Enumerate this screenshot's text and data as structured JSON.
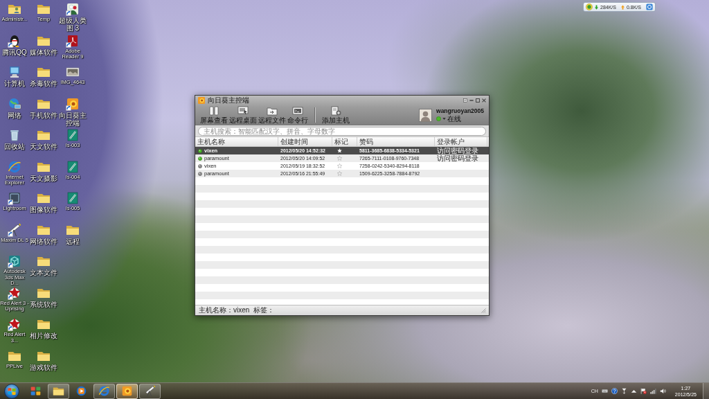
{
  "desktop_icons": [
    {
      "label": "Administr...",
      "kind": "user-folder",
      "shortcut": false
    },
    {
      "label": "腾讯QQ",
      "kind": "penguin",
      "shortcut": true
    },
    {
      "label": "计算机",
      "kind": "computer",
      "shortcut": false
    },
    {
      "label": "网络",
      "kind": "network",
      "shortcut": false
    },
    {
      "label": "回收站",
      "kind": "trash",
      "shortcut": false
    },
    {
      "label": "Internet Explorer",
      "kind": "ie",
      "shortcut": false
    },
    {
      "label": "Lightroom",
      "kind": "dark-tile",
      "shortcut": true
    },
    {
      "label": "Maxim DL 5",
      "kind": "telescope",
      "shortcut": true
    },
    {
      "label": "Autodesk 3ds Max D...",
      "kind": "m-tile",
      "shortcut": true
    },
    {
      "label": "Red Alert 3 - Uprising",
      "kind": "star",
      "shortcut": true
    },
    {
      "label": "Red Alert 3...",
      "kind": "star",
      "shortcut": true
    },
    {
      "label": "PPLive",
      "kind": "folder",
      "shortcut": false
    },
    {
      "label": "Temp",
      "kind": "folder",
      "shortcut": false
    },
    {
      "label": "媒体软件",
      "kind": "folder",
      "shortcut": false
    },
    {
      "label": "杀毒软件",
      "kind": "folder",
      "shortcut": false
    },
    {
      "label": "手机软件",
      "kind": "folder",
      "shortcut": false
    },
    {
      "label": "天文软件",
      "kind": "folder",
      "shortcut": false
    },
    {
      "label": "天文摄影",
      "kind": "folder",
      "shortcut": false
    },
    {
      "label": "图像软件",
      "kind": "folder",
      "shortcut": false
    },
    {
      "label": "网络软件",
      "kind": "folder",
      "shortcut": false
    },
    {
      "label": "文本文件",
      "kind": "folder",
      "shortcut": false
    },
    {
      "label": "系统软件",
      "kind": "folder",
      "shortcut": false
    },
    {
      "label": "相片修改",
      "kind": "folder",
      "shortcut": false
    },
    {
      "label": "游戏软件",
      "kind": "folder",
      "shortcut": false
    },
    {
      "label": "超级人类图 3",
      "kind": "flower",
      "shortcut": true
    },
    {
      "label": "Adobe Reader 9",
      "kind": "pdf",
      "shortcut": true
    },
    {
      "label": "IMG_4643",
      "kind": "photo",
      "shortcut": false
    },
    {
      "label": "向日葵主控端",
      "kind": "sunflower",
      "shortcut": true
    },
    {
      "label": "Is-003",
      "kind": "pen-tile",
      "shortcut": false
    },
    {
      "label": "Is-004",
      "kind": "pen-tile",
      "shortcut": false
    },
    {
      "label": "Is-005",
      "kind": "pen-tile",
      "shortcut": false
    },
    {
      "label": "远程",
      "kind": "folder",
      "shortcut": false
    }
  ],
  "net_widget": {
    "download": "284K/S",
    "upload": "0.8K/S"
  },
  "window": {
    "title": "向日葵主控端",
    "toolbar_groups": [
      {
        "buttons": [
          {
            "label": "屏幕查看",
            "kind": "screen"
          },
          {
            "label": "远程桌面",
            "kind": "desktop"
          },
          {
            "label": "远程文件",
            "kind": "file"
          },
          {
            "label": "命令行",
            "kind": "cmd"
          }
        ]
      },
      {
        "buttons": [
          {
            "label": "添加主机",
            "kind": "add"
          }
        ]
      }
    ],
    "user": {
      "name": "wangruoyan2005",
      "status": "在线",
      "online": true
    },
    "search": {
      "placeholder": "主机搜索：智能匹配汉字、拼音、字母数字"
    },
    "table": {
      "columns": [
        "主机名称",
        "创建时间",
        "标记",
        "赞码",
        "登录帐户"
      ],
      "rows": [
        {
          "name": "vixen",
          "online": true,
          "created": "2012/05/20 14:52:32",
          "starred": true,
          "code": "5811-3685-6838-5334-5321",
          "login": "访问密码登录",
          "selected": true
        },
        {
          "name": "paramount",
          "online": true,
          "created": "2012/05/20 14:09:52",
          "starred": false,
          "code": "7265-7111-0108-9760-7348",
          "login": "访问密码登录",
          "selected": false
        },
        {
          "name": "vixen",
          "online": false,
          "created": "2012/05/19 18:32:52",
          "starred": false,
          "code": "7258-0242-5340-8294-8118",
          "selected": false
        },
        {
          "name": "paramount",
          "online": false,
          "created": "2012/05/16 21:55:49",
          "starred": false,
          "code": "1509-6225-3258-7884-8792",
          "selected": false
        }
      ]
    },
    "status_bar": [
      "主机名称：vixen",
      "标签："
    ]
  },
  "taskbar": {
    "buttons": [
      {
        "kind": "tiles",
        "running": false,
        "selected": false
      },
      {
        "kind": "folder",
        "running": true,
        "selected": false
      },
      {
        "kind": "media",
        "running": false,
        "selected": false
      },
      {
        "kind": "ie",
        "running": true,
        "selected": false
      },
      {
        "kind": "sunflower",
        "running": true,
        "selected": true
      },
      {
        "kind": "telescope",
        "running": true,
        "selected": false
      }
    ],
    "tray": {
      "language": "CH",
      "icons": [
        {
          "kind": "keyboard"
        },
        {
          "kind": "help"
        },
        {
          "kind": "funnel"
        },
        {
          "kind": "caret"
        },
        {
          "kind": "flag"
        },
        {
          "kind": "signal"
        },
        {
          "kind": "speaker"
        }
      ]
    },
    "clock": {
      "time": "1:27",
      "date": "2012/5/25"
    }
  }
}
